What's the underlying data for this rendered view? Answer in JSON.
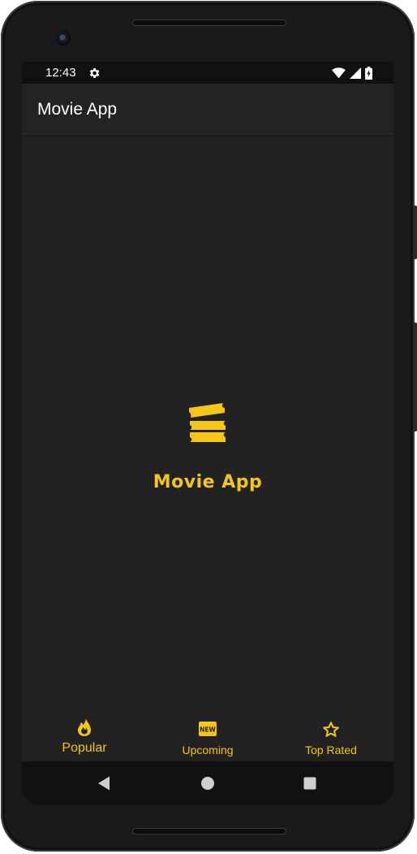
{
  "status_bar": {
    "time": "12:43",
    "icons": [
      "gear-icon",
      "wifi-icon",
      "cellular-signal-icon",
      "battery-charging-icon"
    ]
  },
  "app_bar": {
    "title": "Movie App"
  },
  "splash": {
    "logo_icon": "movie-ticket-icon",
    "title": "Movie App"
  },
  "bottom_nav": {
    "items": [
      {
        "label": "Popular",
        "icon": "fire-icon",
        "active": true
      },
      {
        "label": "Upcoming",
        "icon": "new-badge-icon",
        "badge_text": "NEW",
        "active": false
      },
      {
        "label": "Top Rated",
        "icon": "star-outline-icon",
        "active": false
      }
    ]
  },
  "system_nav": {
    "buttons": [
      "back-icon",
      "home-icon",
      "recents-icon"
    ]
  },
  "colors": {
    "accent": "#f5c518",
    "background": "#222222",
    "status_bar": "#111111",
    "text": "#ffffff"
  }
}
